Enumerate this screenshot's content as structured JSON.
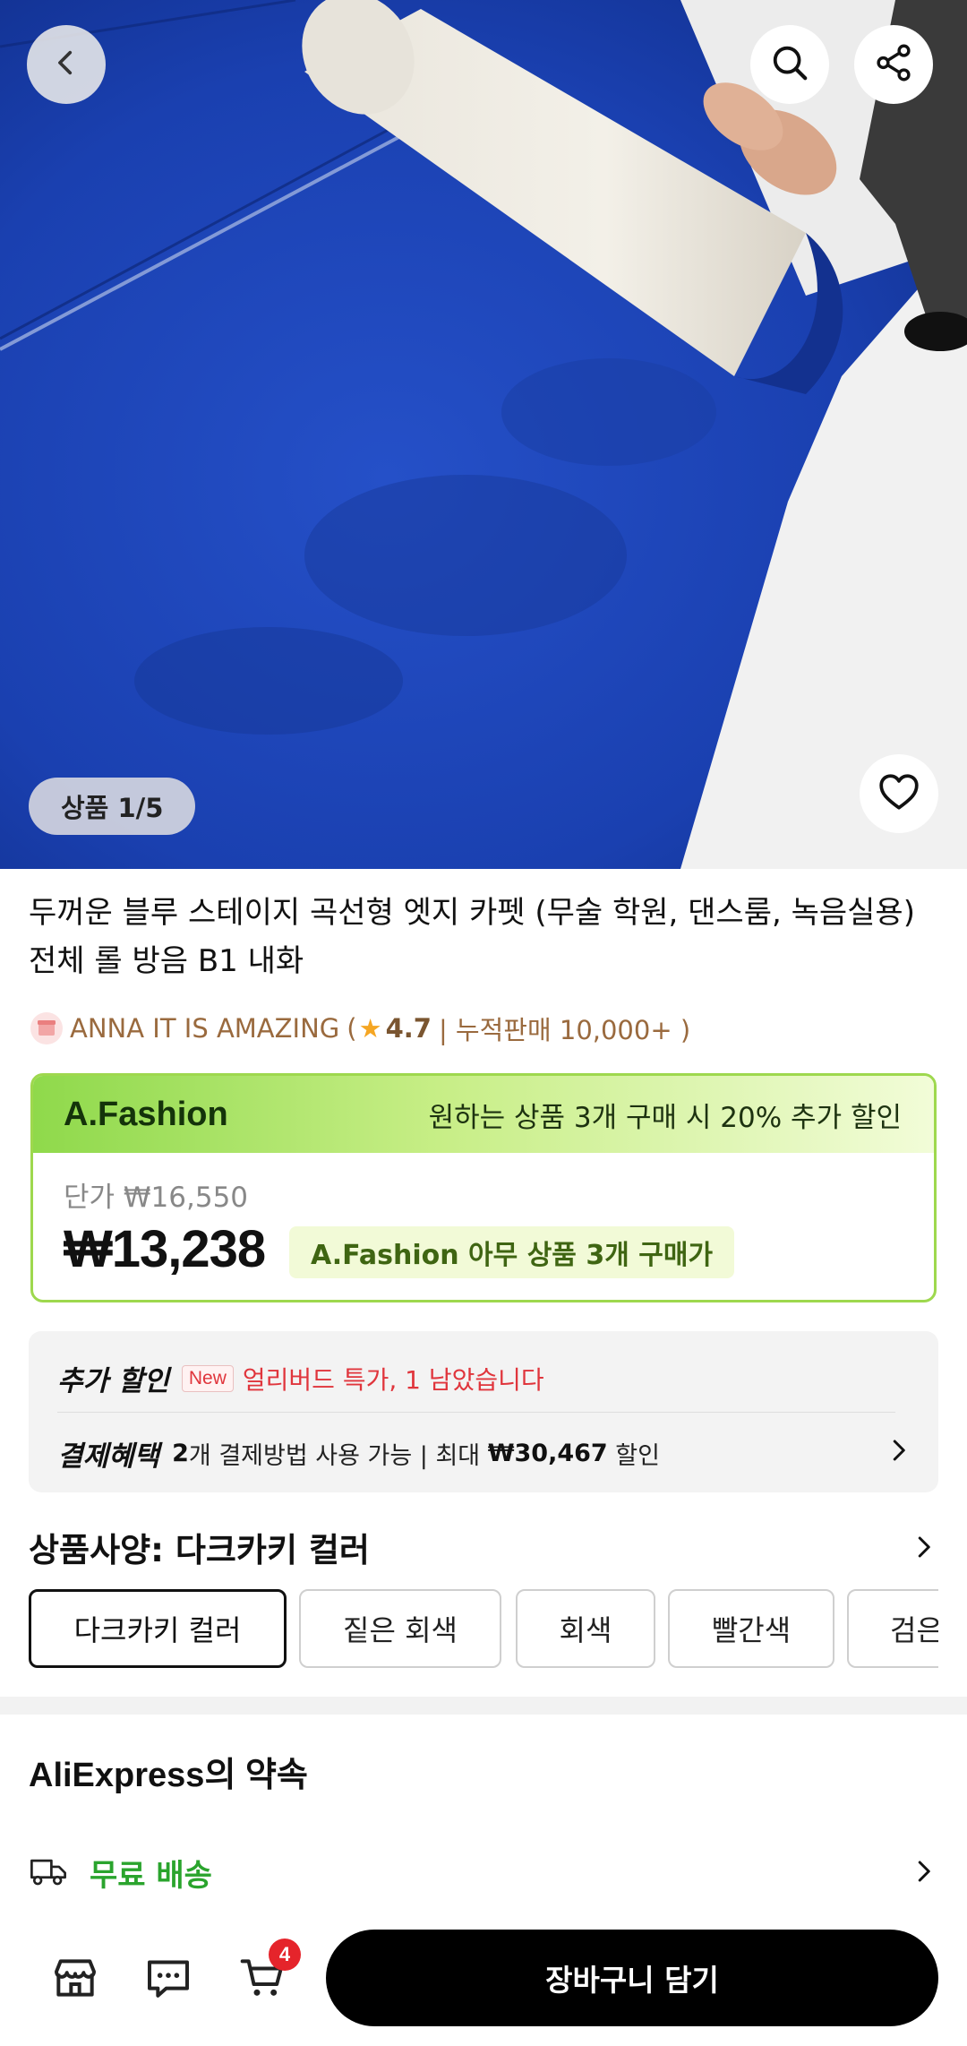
{
  "gallery": {
    "counter": "상품 1/5"
  },
  "product": {
    "title": "두꺼운 블루 스테이지 곡선형 엣지 카펫 (무술 학원, 댄스룸, 녹음실용) 전체 롤 방음 B1 내화"
  },
  "store": {
    "name": "ANNA IT IS AMAZING",
    "open_paren": "(",
    "star": "★",
    "rating": "4.7",
    "sales": "| 누적판매 10,000+ )"
  },
  "promo": {
    "brand": "A.Fashion",
    "note": "원하는 상품 3개 구매 시 20% 추가 할인",
    "unit_price": "단가 ₩16,550",
    "price": "₩13,238",
    "price_tag": "A.Fashion 아무 상품 3개 구매가"
  },
  "benefits": {
    "extra_label": "추가 할인",
    "new_badge": "New",
    "early_bird": "얼리버드 특가, 1 남았습니다",
    "payment_label": "결제혜택",
    "payment_count": "2",
    "payment_text": "개 결제방법 사용 가능 | 최대 ",
    "payment_max": "₩30,467",
    "payment_suffix": " 할인"
  },
  "spec": {
    "title": "상품사양: 다크카키 컬러",
    "options": [
      "다크카키 컬러",
      "짙은 회색",
      "회색",
      "빨간색",
      "검은"
    ]
  },
  "promise": {
    "title": "AliExpress의 약속",
    "shipping": "무료 배송"
  },
  "bottom_bar": {
    "cart_count": "4",
    "add_to_cart": "장바구니 담기"
  },
  "colors": {
    "accent_green": "#9ed84e",
    "shipping_green": "#2aa42d",
    "badge_red": "#e5242b",
    "store_brown": "#9a6a3e"
  },
  "icons": [
    "back-icon",
    "search-icon",
    "share-icon",
    "heart-icon",
    "store-icon",
    "chat-icon",
    "cart-icon",
    "truck-icon",
    "chevron-right-icon"
  ]
}
